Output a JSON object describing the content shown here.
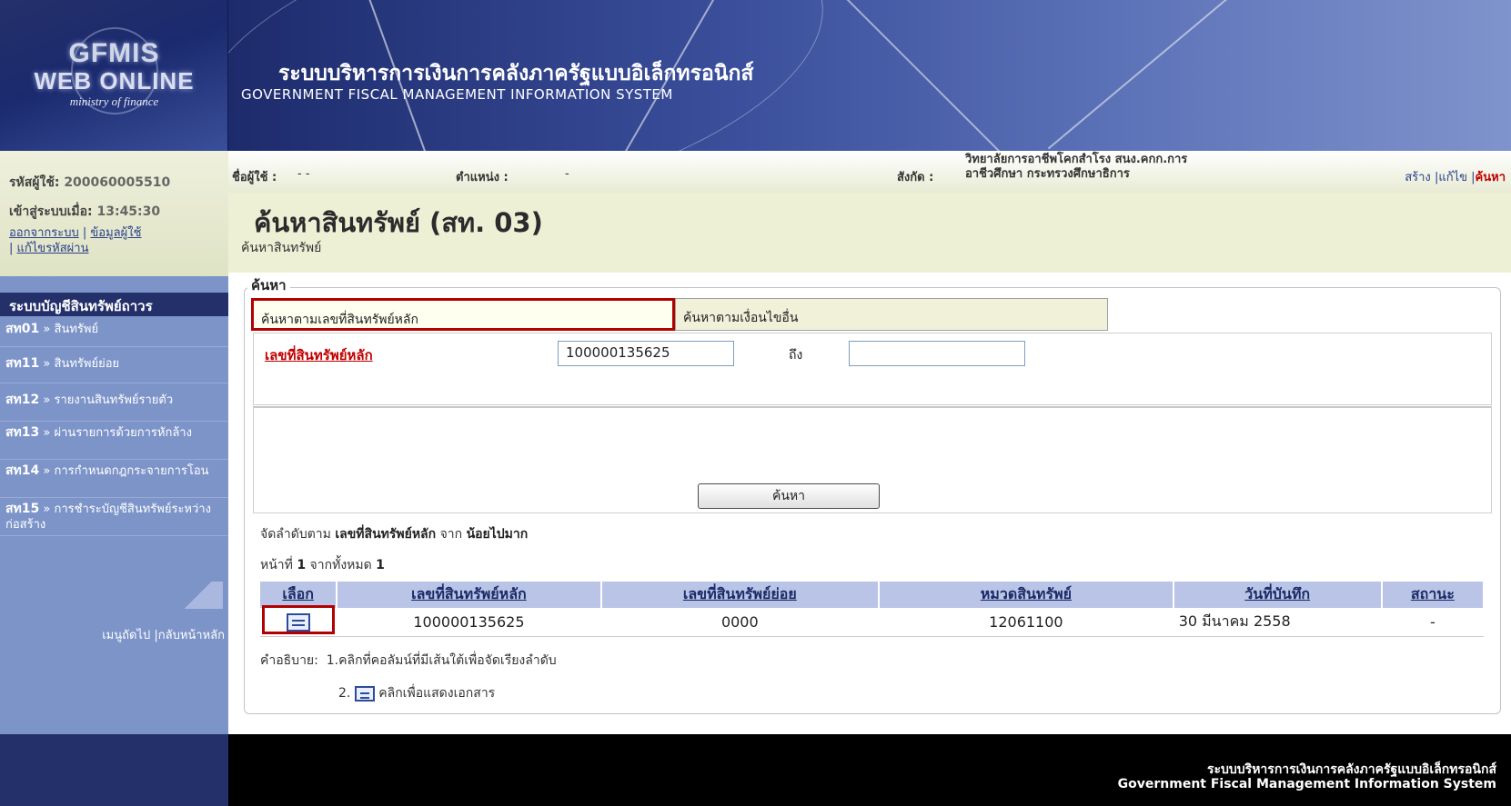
{
  "logo": {
    "line1": "GFMIS",
    "line2": "WEB ONLINE",
    "line3": "ministry of finance"
  },
  "banner": {
    "title_th": "ระบบบริหารการเงินการคลังภาครัฐแบบอิเล็กทรอนิกส์",
    "title_en": "GOVERNMENT FISCAL MANAGEMENT INFORMATION SYSTEM"
  },
  "user": {
    "id_label": "รหัสผู้ใช้:",
    "id_value": "200060005510",
    "login_label": "เข้าสู่ระบบเมื่อ:",
    "login_value": "13:45:30",
    "link_logout": "ออกจากระบบ",
    "link_userinfo": "ข้อมูลผู้ใช้",
    "link_password": "แก้ไขรหัสผ่าน"
  },
  "infobar": {
    "username_label": "ชื่อผู้ใช้ :",
    "username_value": "- -",
    "position_label": "ตำแหน่ง :",
    "position_value": "-",
    "dept_label": "สังกัด :",
    "dept_line1": "วิทยาลัยการอาชีพโคกสำโรง สนง.คกก.การ",
    "dept_line2": "อาชีวศึกษา กระทรวงศึกษาธิการ",
    "action_create": "สร้าง",
    "action_edit": "แก้ไข",
    "action_search": "ค้นหา"
  },
  "sidebar": {
    "header": "ระบบบัญชีสินทรัพย์ถาวร",
    "items": [
      {
        "code": "สท01",
        "label": "สินทรัพย์"
      },
      {
        "code": "สท11",
        "label": "สินทรัพย์ย่อย"
      },
      {
        "code": "สท12",
        "label": "รายงานสินทรัพย์รายตัว"
      },
      {
        "code": "สท13",
        "label": "ผ่านรายการด้วยการหักล้าง"
      },
      {
        "code": "สท14",
        "label": "การกำหนดกฎกระจายการโอน"
      },
      {
        "code": "สท15",
        "label": "การชำระบัญชีสินทรัพย์ระหว่างก่อสร้าง"
      }
    ],
    "arrow": "»",
    "next_menu": "เมนูถัดไป",
    "back_home": "กลับหน้าหลัก"
  },
  "page": {
    "title": "ค้นหาสินทรัพย์ (สท. 03)",
    "subtitle": "ค้นหาสินทรัพย์"
  },
  "search": {
    "legend": "ค้นหา",
    "tab_main": "ค้นหาตามเลขที่สินทรัพย์หลัก",
    "tab_other": "ค้นหาตามเงื่อนไขอื่น",
    "field_label": "เลขที่สินทรัพย์หลัก",
    "from_value": "100000135625",
    "to_label": "ถึง",
    "to_value": "",
    "button": "ค้นหา"
  },
  "results": {
    "sort_prefix": "จัดลำดับตาม",
    "sort_field": "เลขที่สินทรัพย์หลัก",
    "sort_from": "จาก",
    "sort_order": "น้อยไปมาก",
    "page_prefix": "หน้าที่",
    "page_num": "1",
    "page_mid": "จากทั้งหมด",
    "page_total": "1",
    "columns": [
      "เลือก",
      "เลขที่สินทรัพย์หลัก",
      "เลขที่สินทรัพย์ย่อย",
      "หมวดสินทรัพย์",
      "วันที่บันทึก",
      "สถานะ"
    ],
    "rows": [
      {
        "asset_main": "100000135625",
        "asset_sub": "0000",
        "category": "12061100",
        "date": "30 มีนาคม 2558",
        "status": "-"
      }
    ]
  },
  "notes": {
    "label": "คำอธิบาย:",
    "n1": "1.คลิกที่คอลัมน์ที่มีเส้นใต้เพื่อจัดเรียงลำดับ",
    "n2_num": "2.",
    "n2": "คลิกเพื่อแสดงเอกสาร"
  },
  "footer": {
    "th": "ระบบบริหารการเงินการคลังภาครัฐแบบอิเล็กทรอนิกส์",
    "en": "Government Fiscal Management Information System"
  },
  "icons": [
    "document-icon"
  ],
  "colors": {
    "navy": "#24306a",
    "sidebar": "#7d94c9",
    "accent_red": "#c00000",
    "table_header": "#b9c4e6"
  }
}
